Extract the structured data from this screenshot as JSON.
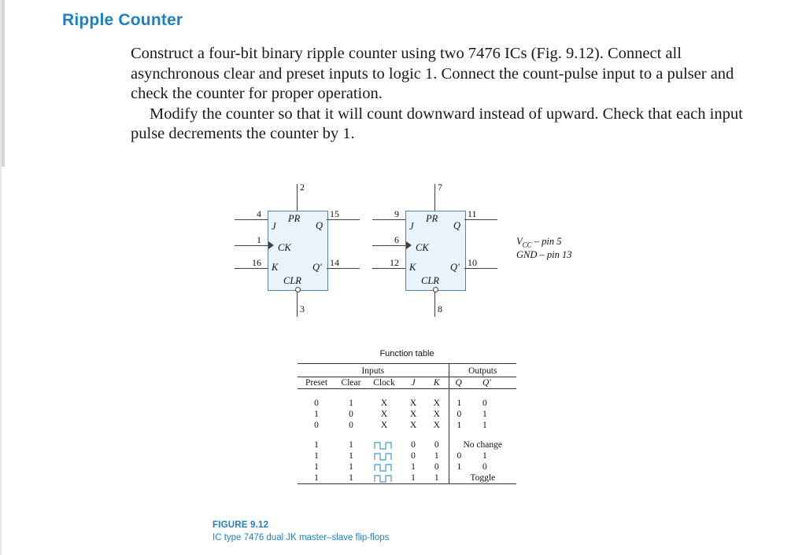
{
  "header": {
    "title": "Ripple Counter"
  },
  "body": {
    "paragraph1": "Construct a four-bit binary ripple counter using two 7476 ICs (Fig. 9.12). Connect all asynchronous clear and preset inputs to logic 1. Connect the count-pulse input to a pulser and check the counter for proper operation.",
    "paragraph2": "Modify the counter so that it will count downward instead of upward. Check that each input pulse decrements the counter by 1."
  },
  "figure": {
    "ff1": {
      "pr_label": "PR",
      "clr_label": "CLR",
      "j_label": "J",
      "k_label": "K",
      "ck_label": "CK",
      "q_label": "Q",
      "qn_label": "Q'",
      "pin_pr": "2",
      "pin_clr": "3",
      "pin_j": "4",
      "pin_ck": "1",
      "pin_k": "16",
      "pin_q": "15",
      "pin_qn": "14"
    },
    "ff2": {
      "pr_label": "PR",
      "clr_label": "CLR",
      "j_label": "J",
      "k_label": "K",
      "ck_label": "CK",
      "q_label": "Q",
      "qn_label": "Q'",
      "pin_pr": "7",
      "pin_clr": "8",
      "pin_j": "9",
      "pin_ck": "6",
      "pin_k": "12",
      "pin_q": "11",
      "pin_qn": "10"
    },
    "notes": {
      "vcc": "V",
      "vcc_sub": "CC",
      "vcc_rest": " – pin 5",
      "gnd": "GND – pin 13"
    }
  },
  "function_table": {
    "title": "Function table",
    "group_headers": [
      "Inputs",
      "Outputs"
    ],
    "columns": [
      "Preset",
      "Clear",
      "Clock",
      "J",
      "K",
      "Q",
      "Q'"
    ],
    "rows_block1": [
      [
        "0",
        "1",
        "X",
        "X",
        "X",
        "1",
        "0"
      ],
      [
        "1",
        "0",
        "X",
        "X",
        "X",
        "0",
        "1"
      ],
      [
        "0",
        "0",
        "X",
        "X",
        "X",
        "1",
        "1"
      ]
    ],
    "rows_block2": [
      [
        "1",
        "1",
        "clock-pulse",
        "0",
        "0",
        "No change",
        ""
      ],
      [
        "1",
        "1",
        "clock-pulse",
        "0",
        "1",
        "0",
        "1"
      ],
      [
        "1",
        "1",
        "clock-pulse",
        "1",
        "0",
        "1",
        "0"
      ],
      [
        "1",
        "1",
        "clock-pulse",
        "1",
        "1",
        "Toggle",
        ""
      ]
    ]
  },
  "caption": {
    "number": "FIGURE 9.12",
    "text": "IC type 7476 dual JK master–slave flip-flops"
  }
}
